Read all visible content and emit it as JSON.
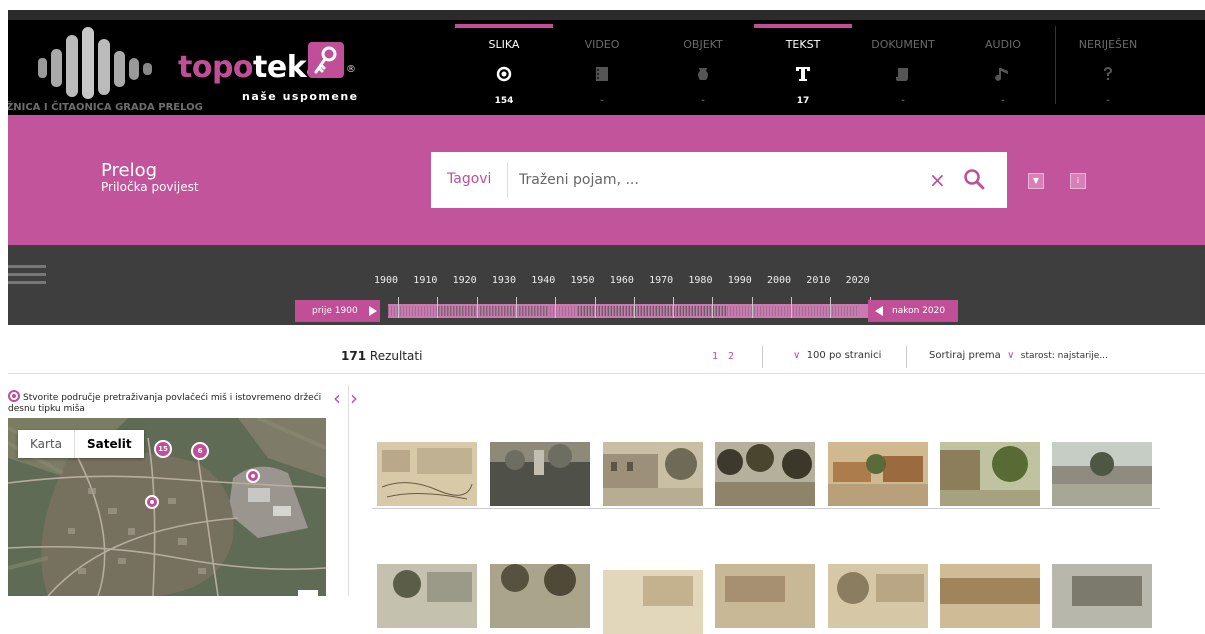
{
  "brand": {
    "name_part1": "topo",
    "name_part2": "teka",
    "registered": "®",
    "slogan": "naše uspomene",
    "library": "ŽNICA I ČITAONICA GRADA PRELOG"
  },
  "media_tabs": [
    {
      "label": "SLIKA",
      "count": "154",
      "icon": "circle-dot-icon",
      "active": true
    },
    {
      "label": "VIDEO",
      "count": "-",
      "icon": "film-icon",
      "active": false
    },
    {
      "label": "OBJEKT",
      "count": "-",
      "icon": "vase-icon",
      "active": false
    },
    {
      "label": "TEKST",
      "count": "17",
      "icon": "text-t-icon",
      "active": true
    },
    {
      "label": "DOKUMENT",
      "count": "-",
      "icon": "scroll-icon",
      "active": false
    },
    {
      "label": "AUDIO",
      "count": "-",
      "icon": "music-note-icon",
      "active": false
    },
    {
      "label": "NERIJEŠEN",
      "count": "-",
      "icon": "question-icon",
      "active": false
    }
  ],
  "place": {
    "title": "Prelog",
    "subtitle": "Priločka povijest"
  },
  "search": {
    "tags_label": "Tagovi",
    "placeholder": "Traženi pojam, ...",
    "value": "",
    "clear_symbol": "×",
    "options_symbol": "▼",
    "info_symbol": "i"
  },
  "timeline": {
    "years": [
      "1900",
      "1910",
      "1920",
      "1930",
      "1940",
      "1950",
      "1960",
      "1970",
      "1980",
      "1990",
      "2000",
      "2010",
      "2020"
    ],
    "before_label": "prije 1900",
    "after_label": "nakon 2020"
  },
  "results": {
    "count": "171",
    "label": "Rezultati",
    "pages": [
      "1",
      "2"
    ],
    "per_page": "100 po stranici",
    "sort_label": "Sortiraj prema",
    "sort_value": "starost: najstarije..."
  },
  "map": {
    "hint": "Stvorite područje pretraživanja povlačeći miš i istovremeno držeći desnu tipku miša",
    "type_map": "Karta",
    "type_satellite": "Satelit",
    "active_type": "Satelit",
    "clusters": [
      "15",
      "6"
    ]
  },
  "colors": {
    "accent": "#c14f97",
    "band": "#c1549b",
    "header_bg": "#000000",
    "timeline_bg": "#3e3e3e"
  }
}
